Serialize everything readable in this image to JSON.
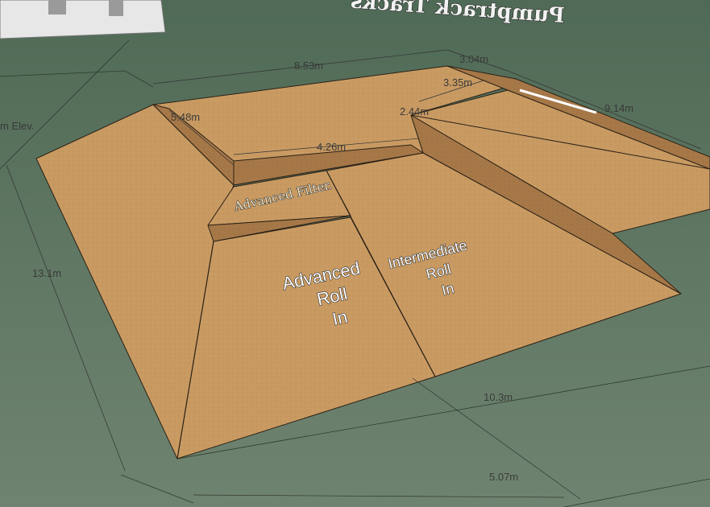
{
  "scene": {
    "background_text": "Pumptrack Tracks",
    "dimensions": {
      "top": "8.53m",
      "top_right": "3.04m",
      "right": "9.14m",
      "inner_top_right": "3.35m",
      "inner_left": "5.48m",
      "inner_height": "2.44m",
      "inner_bottom": "4.26m",
      "left_elev": "m Elev.",
      "left": "13.1m",
      "bottom_right": "10.3m",
      "bottom": "5.07m"
    },
    "labels": {
      "advanced_filter": "Advanced Filter.",
      "advanced_roll_in": [
        "Advanced",
        "Roll",
        "In"
      ],
      "intermediate_roll_in": [
        "Intermediate",
        "Roll",
        "In"
      ]
    }
  },
  "colors": {
    "ground": "#5f7563",
    "ramp_light": "#c89a62",
    "ramp_mid": "#b8874f",
    "ramp_dark": "#8a6236",
    "edge": "#2b2116"
  }
}
